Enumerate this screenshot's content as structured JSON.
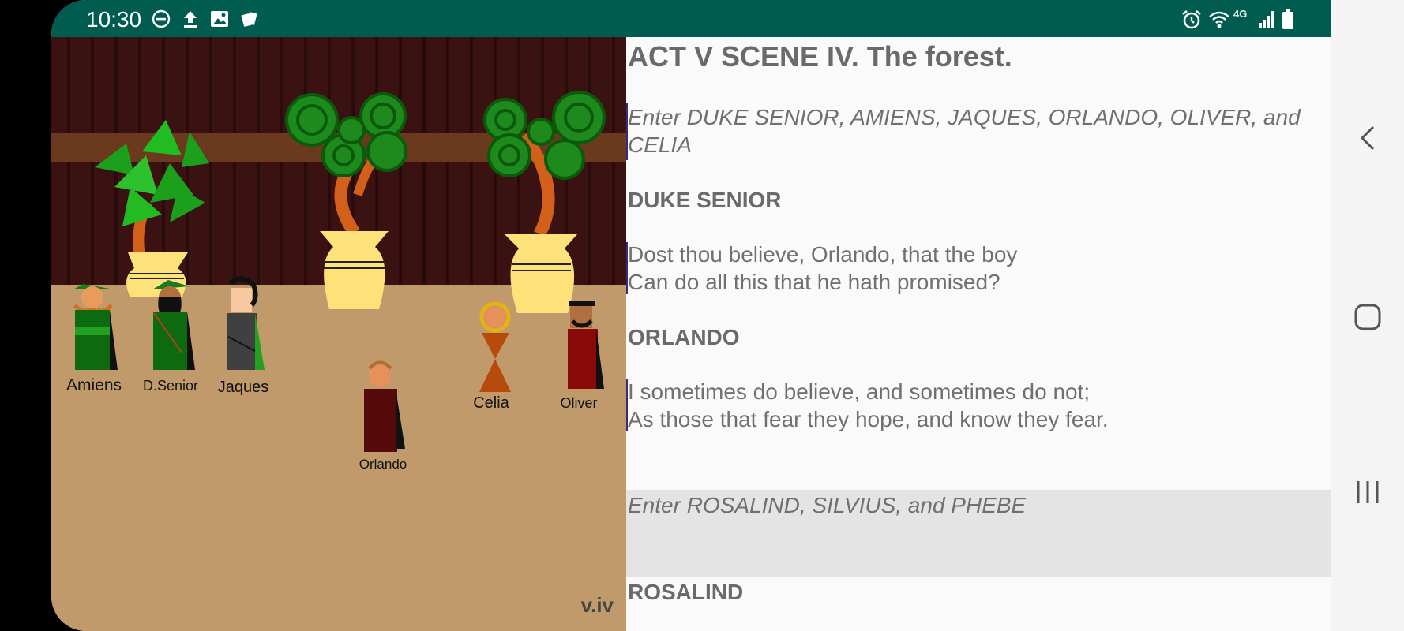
{
  "status_bar": {
    "time": "10:30",
    "left_icons": [
      "do-not-disturb-icon",
      "upload-icon",
      "gallery-icon",
      "cards-icon"
    ],
    "right_icons": [
      "alarm-icon",
      "wifi-icon",
      "network-4g-icon",
      "signal-icon",
      "battery-icon"
    ],
    "network_label": "4G"
  },
  "stage": {
    "characters": [
      "Amiens",
      "D.Senior",
      "Jaques",
      "Orlando",
      "Celia",
      "Oliver"
    ],
    "scene_tag": "v.iv"
  },
  "script": {
    "title": "ACT V SCENE IV. The forest.",
    "entries": [
      {
        "kind": "direction",
        "lines": [
          "Enter DUKE SENIOR, AMIENS, JAQUES, ORLANDO, OLIVER, and",
          "CELIA"
        ]
      },
      {
        "kind": "speaker",
        "name": "DUKE SENIOR"
      },
      {
        "kind": "speech",
        "lines": [
          "Dost thou believe, Orlando, that the boy",
          "Can do all this that he hath promised?"
        ]
      },
      {
        "kind": "speaker",
        "name": "ORLANDO"
      },
      {
        "kind": "speech",
        "lines": [
          "I sometimes do believe, and sometimes do not;",
          "As those that fear they hope, and know they fear."
        ]
      },
      {
        "kind": "direction",
        "lines": [
          "Enter ROSALIND, SILVIUS, and PHEBE"
        ],
        "highlighted": true
      },
      {
        "kind": "speaker",
        "name": "ROSALIND"
      }
    ]
  },
  "colors": {
    "status_bar": "#005c4f",
    "floor": "#c19a6b",
    "curtain": "#3a1212",
    "highlight": "#e4e4e4"
  },
  "nav_bar": {
    "buttons": [
      "back-icon",
      "home-icon",
      "recents-icon"
    ]
  }
}
